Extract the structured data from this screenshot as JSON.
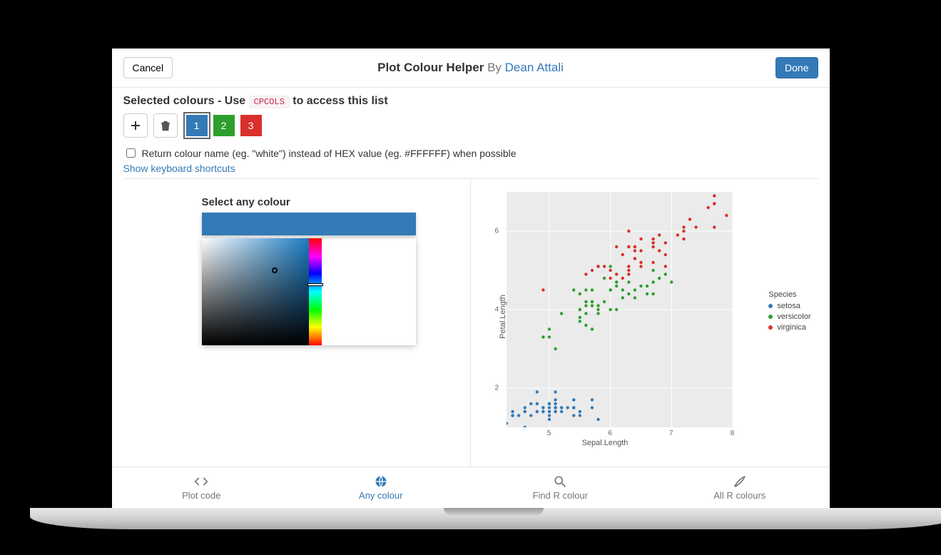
{
  "header": {
    "cancel": "Cancel",
    "done": "Done",
    "title": "Plot Colour Helper",
    "by": "By",
    "author": "Dean Attali"
  },
  "selected": {
    "prefix": "Selected colours - Use",
    "code": "CPCOLS",
    "suffix": "to access this list"
  },
  "swatches": [
    {
      "label": "1",
      "color": "#337ab7",
      "active": true
    },
    {
      "label": "2",
      "color": "#2e9f2e",
      "active": false
    },
    {
      "label": "3",
      "color": "#d9302c",
      "active": false
    }
  ],
  "options": {
    "return_name_label": "Return colour name (eg. \"white\") instead of HEX value (eg. #FFFFFF) when possible",
    "shortcuts_link": "Show keyboard shortcuts"
  },
  "picker": {
    "label": "Select any colour",
    "value": ""
  },
  "tabs": {
    "code": "Plot code",
    "any": "Any colour",
    "find": "Find R colour",
    "all": "All R colours"
  },
  "chart_data": {
    "type": "scatter",
    "xlabel": "Sepal.Length",
    "ylabel": "Petal.Length",
    "xlim": [
      4.3,
      8.0
    ],
    "ylim": [
      1.0,
      7.0
    ],
    "xticks": [
      5,
      6,
      7,
      8
    ],
    "yticks": [
      2,
      4,
      6
    ],
    "legend_title": "Species",
    "series": [
      {
        "name": "setosa",
        "color": "#337ab7",
        "points": [
          [
            5.1,
            1.4
          ],
          [
            4.9,
            1.4
          ],
          [
            4.7,
            1.3
          ],
          [
            4.6,
            1.5
          ],
          [
            5.0,
            1.4
          ],
          [
            5.4,
            1.7
          ],
          [
            4.6,
            1.4
          ],
          [
            5.0,
            1.5
          ],
          [
            4.4,
            1.4
          ],
          [
            4.9,
            1.5
          ],
          [
            5.4,
            1.5
          ],
          [
            4.8,
            1.6
          ],
          [
            4.8,
            1.4
          ],
          [
            4.3,
            1.1
          ],
          [
            5.8,
            1.2
          ],
          [
            5.7,
            1.5
          ],
          [
            5.4,
            1.3
          ],
          [
            5.1,
            1.4
          ],
          [
            5.7,
            1.7
          ],
          [
            5.1,
            1.5
          ],
          [
            5.4,
            1.7
          ],
          [
            5.1,
            1.5
          ],
          [
            4.6,
            1.0
          ],
          [
            5.1,
            1.7
          ],
          [
            4.8,
            1.9
          ],
          [
            5.0,
            1.6
          ],
          [
            5.0,
            1.6
          ],
          [
            5.2,
            1.5
          ],
          [
            5.2,
            1.4
          ],
          [
            4.7,
            1.6
          ],
          [
            4.8,
            1.6
          ],
          [
            5.4,
            1.5
          ],
          [
            5.2,
            1.5
          ],
          [
            5.5,
            1.4
          ],
          [
            4.9,
            1.5
          ],
          [
            5.0,
            1.2
          ],
          [
            5.5,
            1.3
          ],
          [
            4.9,
            1.4
          ],
          [
            4.4,
            1.3
          ],
          [
            5.1,
            1.5
          ],
          [
            5.0,
            1.3
          ],
          [
            4.5,
            1.3
          ],
          [
            4.4,
            1.3
          ],
          [
            5.0,
            1.6
          ],
          [
            5.1,
            1.9
          ],
          [
            4.8,
            1.4
          ],
          [
            5.1,
            1.6
          ],
          [
            4.6,
            1.4
          ],
          [
            5.3,
            1.5
          ],
          [
            5.0,
            1.4
          ]
        ]
      },
      {
        "name": "versicolor",
        "color": "#2e9f2e",
        "points": [
          [
            7.0,
            4.7
          ],
          [
            6.4,
            4.5
          ],
          [
            6.9,
            4.9
          ],
          [
            5.5,
            4.0
          ],
          [
            6.5,
            4.6
          ],
          [
            5.7,
            4.5
          ],
          [
            6.3,
            4.7
          ],
          [
            4.9,
            3.3
          ],
          [
            6.6,
            4.6
          ],
          [
            5.2,
            3.9
          ],
          [
            5.0,
            3.5
          ],
          [
            5.9,
            4.2
          ],
          [
            6.0,
            4.0
          ],
          [
            6.1,
            4.7
          ],
          [
            5.6,
            3.6
          ],
          [
            6.7,
            4.4
          ],
          [
            5.6,
            4.5
          ],
          [
            5.8,
            4.1
          ],
          [
            6.2,
            4.5
          ],
          [
            5.6,
            3.9
          ],
          [
            5.9,
            4.8
          ],
          [
            6.1,
            4.0
          ],
          [
            6.3,
            4.9
          ],
          [
            6.1,
            4.7
          ],
          [
            6.4,
            4.3
          ],
          [
            6.6,
            4.4
          ],
          [
            6.8,
            4.8
          ],
          [
            6.7,
            5.0
          ],
          [
            6.0,
            4.5
          ],
          [
            5.7,
            3.5
          ],
          [
            5.5,
            3.8
          ],
          [
            5.5,
            3.7
          ],
          [
            5.8,
            3.9
          ],
          [
            6.0,
            5.1
          ],
          [
            5.4,
            4.5
          ],
          [
            6.0,
            4.5
          ],
          [
            6.7,
            4.7
          ],
          [
            6.3,
            4.4
          ],
          [
            5.6,
            4.1
          ],
          [
            5.5,
            4.0
          ],
          [
            5.5,
            4.4
          ],
          [
            6.1,
            4.6
          ],
          [
            5.8,
            4.0
          ],
          [
            5.0,
            3.3
          ],
          [
            5.6,
            4.2
          ],
          [
            5.7,
            4.2
          ],
          [
            5.7,
            4.2
          ],
          [
            6.2,
            4.3
          ],
          [
            5.1,
            3.0
          ],
          [
            5.7,
            4.1
          ]
        ]
      },
      {
        "name": "virginica",
        "color": "#d9302c",
        "points": [
          [
            6.3,
            6.0
          ],
          [
            5.8,
            5.1
          ],
          [
            7.1,
            5.9
          ],
          [
            6.3,
            5.6
          ],
          [
            6.5,
            5.8
          ],
          [
            7.6,
            6.6
          ],
          [
            4.9,
            4.5
          ],
          [
            7.3,
            6.3
          ],
          [
            6.7,
            5.8
          ],
          [
            7.2,
            6.1
          ],
          [
            6.5,
            5.1
          ],
          [
            6.4,
            5.3
          ],
          [
            6.8,
            5.5
          ],
          [
            5.7,
            5.0
          ],
          [
            5.8,
            5.1
          ],
          [
            6.4,
            5.3
          ],
          [
            6.5,
            5.5
          ],
          [
            7.7,
            6.7
          ],
          [
            7.7,
            6.9
          ],
          [
            6.0,
            5.0
          ],
          [
            6.9,
            5.7
          ],
          [
            5.6,
            4.9
          ],
          [
            7.7,
            6.7
          ],
          [
            6.3,
            4.9
          ],
          [
            6.7,
            5.7
          ],
          [
            7.2,
            6.0
          ],
          [
            6.2,
            4.8
          ],
          [
            6.1,
            4.9
          ],
          [
            6.4,
            5.6
          ],
          [
            7.2,
            5.8
          ],
          [
            7.4,
            6.1
          ],
          [
            7.9,
            6.4
          ],
          [
            6.4,
            5.6
          ],
          [
            6.3,
            5.1
          ],
          [
            6.1,
            5.6
          ],
          [
            7.7,
            6.1
          ],
          [
            6.3,
            5.6
          ],
          [
            6.4,
            5.5
          ],
          [
            6.0,
            4.8
          ],
          [
            6.9,
            5.4
          ],
          [
            6.7,
            5.6
          ],
          [
            6.9,
            5.1
          ],
          [
            5.8,
            5.1
          ],
          [
            6.8,
            5.9
          ],
          [
            6.7,
            5.7
          ],
          [
            6.7,
            5.2
          ],
          [
            6.3,
            5.0
          ],
          [
            6.5,
            5.2
          ],
          [
            6.2,
            5.4
          ],
          [
            5.9,
            5.1
          ]
        ]
      }
    ]
  }
}
